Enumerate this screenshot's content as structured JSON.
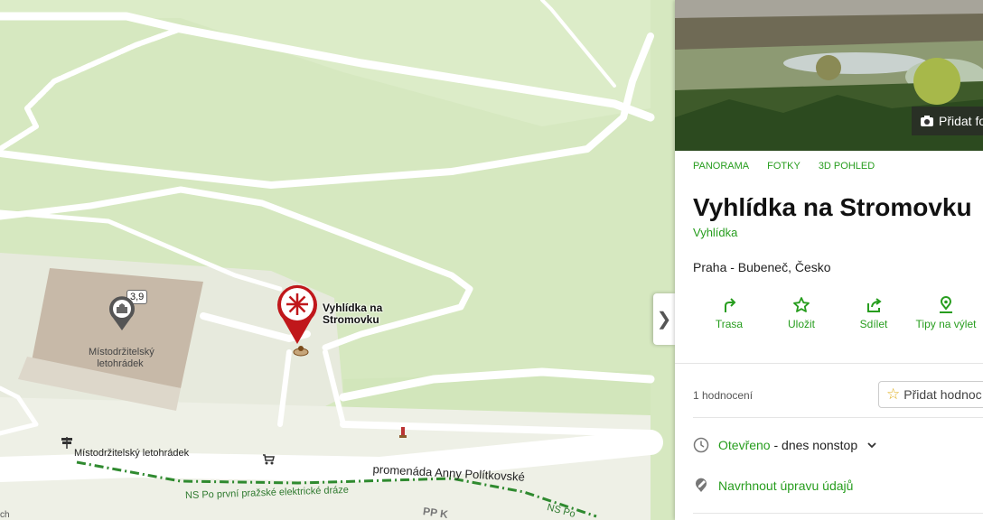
{
  "map": {
    "building_name": "Místodržitelský letohrádek",
    "building_rating": "3,9",
    "poi_label": "Vyhlídka na Stromovku",
    "sign_label": "Místodržitelský letohrádek",
    "promenade_label": "promenáda Anny Polítkovské",
    "trail_label": "NS Po první pražské elektrické dráze",
    "trail_label_2": "NS Po",
    "path_label_partial": "PP K",
    "edge_label": "ch",
    "colors": {
      "park": "#d6e8c0",
      "road": "#ffffff",
      "building": "#c7b9a8",
      "trail": "#2f8a2f",
      "poi_red": "#c0171b"
    }
  },
  "panel": {
    "add_photo_label": "Přidat fo",
    "tabs": [
      "PANORAMA",
      "FOTKY",
      "3D POHLED"
    ],
    "title": "Vyhlídka na Stromovku",
    "category": "Vyhlídka",
    "address": "Praha - Bubeneč, Česko",
    "actions": [
      {
        "label": "Trasa",
        "icon": "route-icon"
      },
      {
        "label": "Uložit",
        "icon": "star-icon"
      },
      {
        "label": "Sdílet",
        "icon": "share-icon"
      },
      {
        "label": "Tipy na výlet",
        "icon": "location-pin-icon"
      }
    ],
    "ratings_count": "1 hodnocení",
    "rate_button": "Přidat hodnoc",
    "open_status": "Otevřeno",
    "open_detail": " - dnes nonstop",
    "suggest_edit": "Navrhnout úpravu údajů",
    "accent": "#279d1e"
  }
}
